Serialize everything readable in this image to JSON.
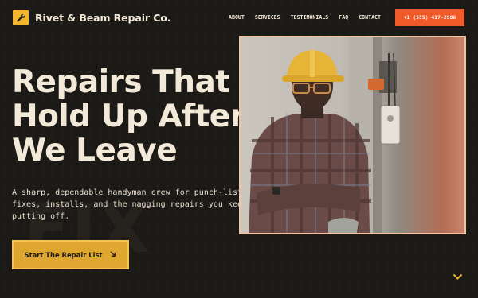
{
  "brand": {
    "name": "Rivet & Beam Repair Co.",
    "icon": "wrench-icon",
    "accent": "#f2b52b"
  },
  "nav": {
    "links": [
      "About",
      "Services",
      "Testimonials",
      "FAQ",
      "Contact"
    ]
  },
  "header_cta": {
    "label": "+1 (555) 417-2986",
    "color": "#f05a28"
  },
  "hero": {
    "title_lines": [
      "Repairs That",
      "Hold Up After",
      "We Leave"
    ],
    "background_word": "FIX",
    "description": "A sharp, dependable handyman crew for punch-lists, fixes, installs, and the nagging repairs you keep putting off.",
    "cta_label": "Start The Repair List",
    "cta_icon": "arrow-down-right-icon",
    "cta_color": "#e0a730"
  },
  "photo": {
    "subject": "worker-in-hard-hat-photo"
  },
  "scroll": {
    "icon": "chevron-down-icon",
    "color": "#f2b52b"
  }
}
